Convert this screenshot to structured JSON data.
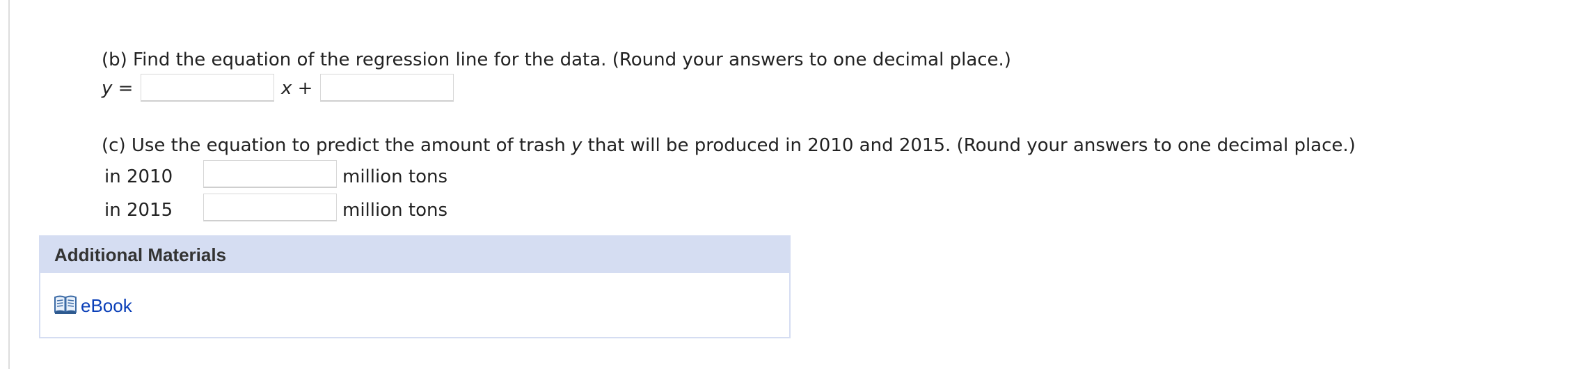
{
  "part_b": {
    "question": "(b) Find the equation of the regression line for the data. (Round your answers to one decimal place.)",
    "y_label": "y",
    "equals": "=",
    "x_label": "x",
    "plus": "+",
    "slope_value": "",
    "intercept_value": ""
  },
  "part_c": {
    "question_before": "(c) Use the equation to predict the amount of trash ",
    "question_var": "y",
    "question_after": " that will be produced in 2010 and 2015. (Round your answers to one decimal place.)",
    "rows": [
      {
        "label": "in 2010",
        "value": "",
        "unit": "million tons"
      },
      {
        "label": "in 2015",
        "value": "",
        "unit": "million tons"
      }
    ]
  },
  "additional_materials": {
    "title": "Additional Materials",
    "ebook_icon": "book-icon",
    "ebook_label": "eBook"
  }
}
